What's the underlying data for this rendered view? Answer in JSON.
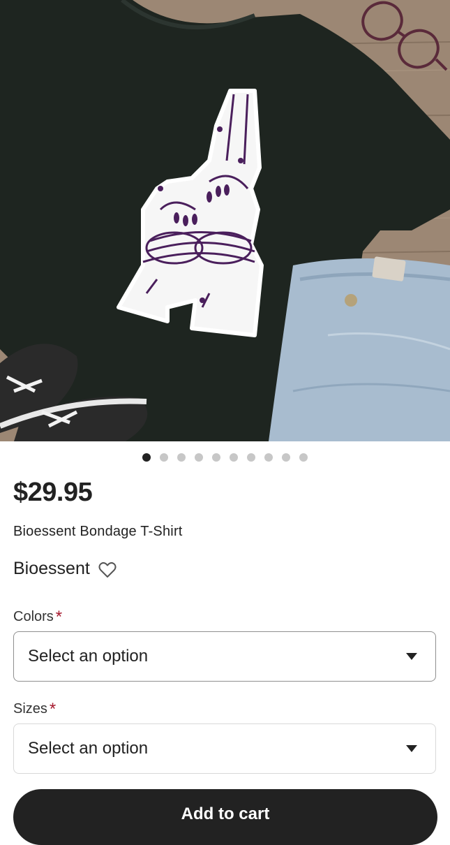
{
  "product": {
    "image_alt": "Black t-shirt with bound hands graphic, jeans, sneakers and glasses on wooden floor",
    "carousel": {
      "count": 10,
      "active_index": 0
    },
    "price": "$29.95",
    "title": "Bioessent Bondage T-Shirt",
    "shop_name": "Bioessent"
  },
  "options": {
    "colors": {
      "label": "Colors",
      "required_mark": "*",
      "value": "Select an option"
    },
    "sizes": {
      "label": "Sizes",
      "required_mark": "*",
      "value": "Select an option"
    }
  },
  "actions": {
    "add_to_cart": "Add to cart"
  },
  "icons": {
    "favorite": "heart-outline-icon",
    "dropdown": "caret-down-icon"
  },
  "colors": {
    "primary_dark": "#222222",
    "required_red": "#a61a2e",
    "tshirt": "#1e2520",
    "accent_purple": "#4a1f5c"
  }
}
